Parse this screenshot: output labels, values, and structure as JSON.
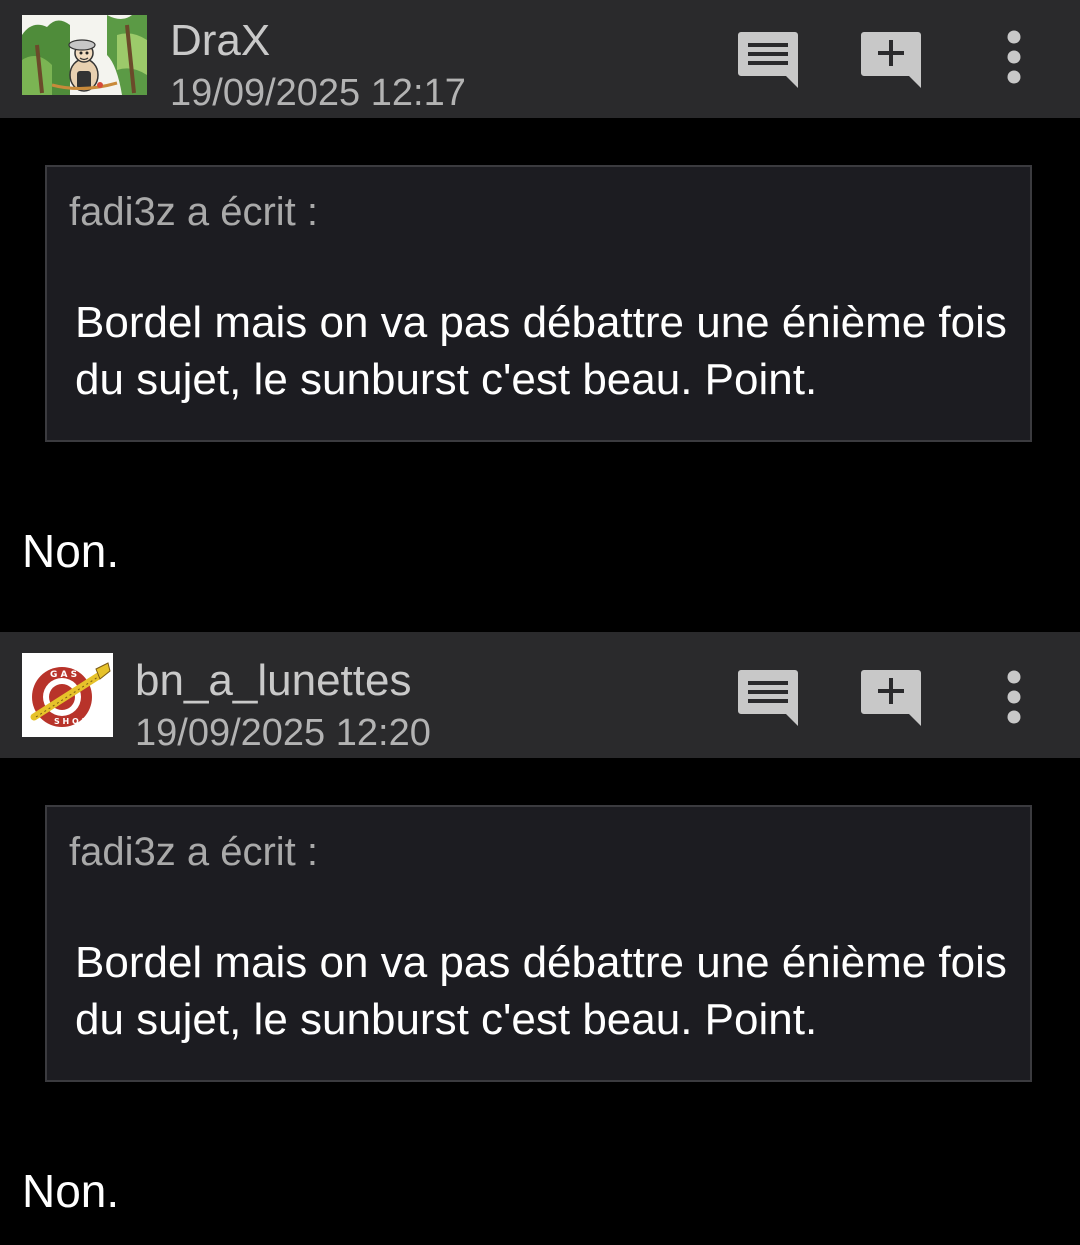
{
  "posts": [
    {
      "username": "DraX",
      "timestamp": "19/09/2025 12:17",
      "quote": {
        "author_line": "fadi3z a écrit :",
        "text": "Bordel mais on va pas débattre une énième fois du sujet, le sunburst c'est beau. Point."
      },
      "message": "Non.",
      "avatar": "cartoon-forest-avatar"
    },
    {
      "username": "bn_a_lunettes",
      "timestamp": "19/09/2025 12:20",
      "quote": {
        "author_line": "fadi3z a écrit :",
        "text": "Bordel mais on va pas débattre une énième fois du sujet, le sunburst c'est beau. Point."
      },
      "message": "Non.",
      "avatar": "gas-shop-guitar-logo"
    }
  ],
  "header_actions": {
    "reply_icon": "message-lines-icon",
    "quote_icon": "message-plus-icon",
    "more_icon": "more-vertical-icon"
  },
  "colors": {
    "background": "#000000",
    "header_bg": "#2a2a2c",
    "quote_bg": "#1c1c21",
    "quote_border": "#3b3b3f",
    "icon_color": "#c8c8c8"
  }
}
